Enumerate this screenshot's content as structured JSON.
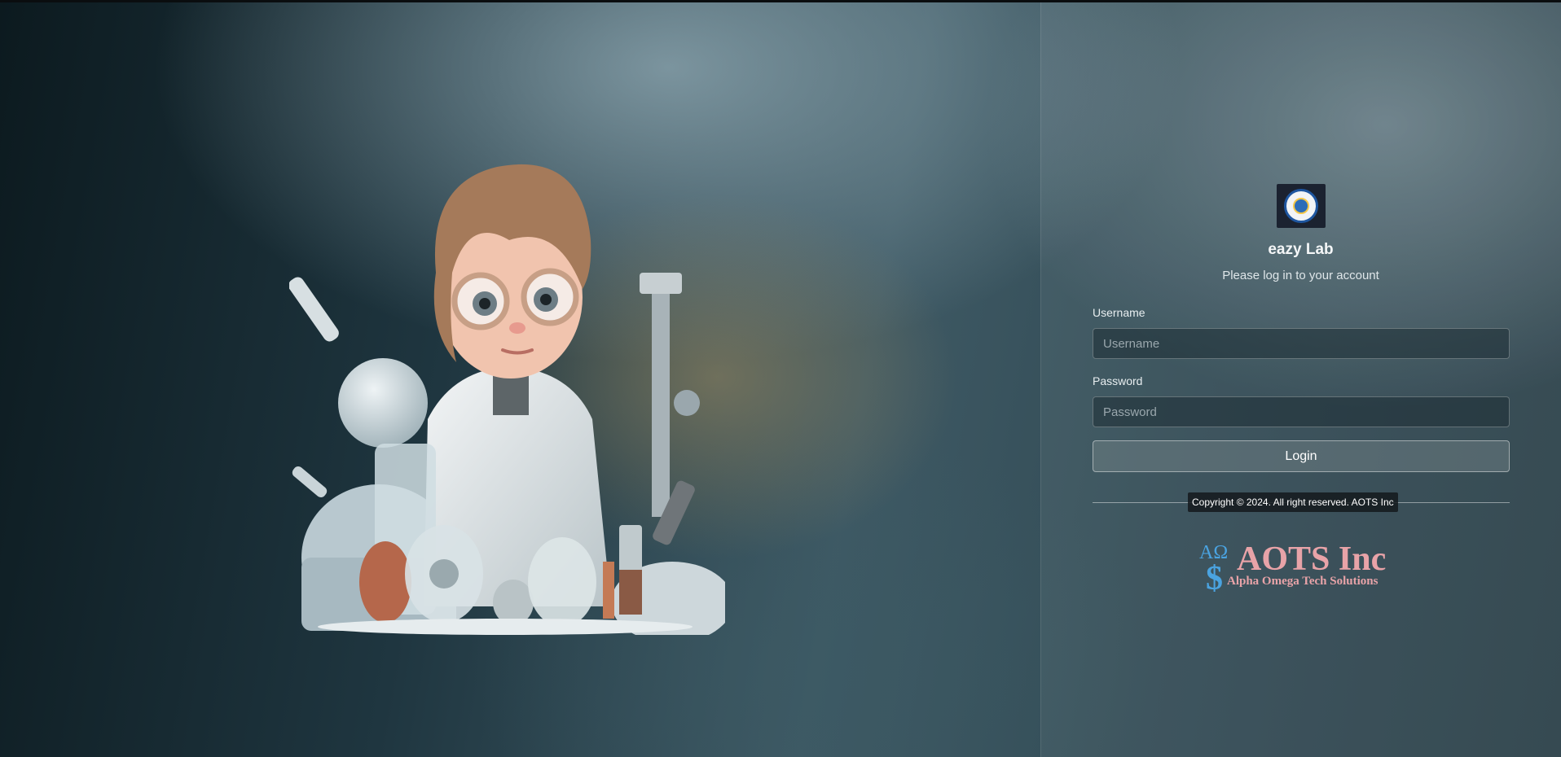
{
  "login": {
    "app_title": "eazy Lab",
    "subtitle": "Please log in to your account",
    "username_label": "Username",
    "username_placeholder": "Username",
    "username_value": "",
    "password_label": "Password",
    "password_placeholder": "Password",
    "password_value": "",
    "login_button": "Login"
  },
  "footer": {
    "copyright": "Copyright © 2024. All right reserved. AOTS Inc",
    "brand_name": "AOTS Inc",
    "brand_tagline": "Alpha Omega Tech Solutions",
    "brand_symbols": "AΩ",
    "brand_dollar": "$"
  },
  "colors": {
    "brand_pink": "#e8a3a8",
    "brand_blue": "#4aa3e0",
    "logo_border": "#1e56a0"
  },
  "icons": {
    "hero": "scientist-illustration",
    "org_logo": "organization-seal-logo"
  }
}
